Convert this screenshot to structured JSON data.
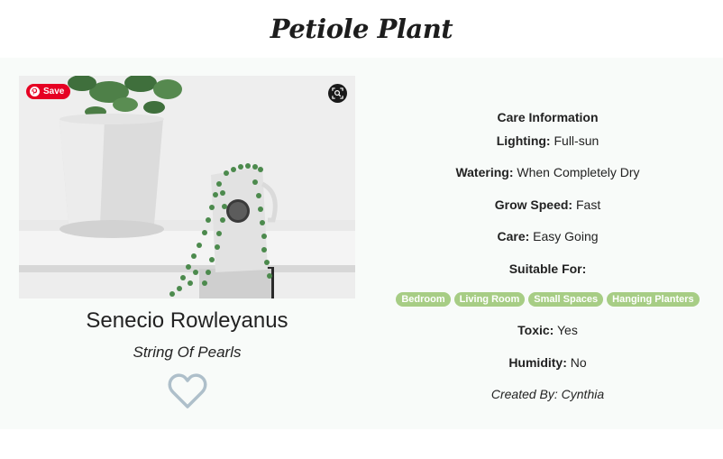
{
  "header": {
    "title": "Petiole Plant"
  },
  "photo": {
    "save_label": "Save",
    "alt": "String of pearls plant in a white pitcher next to a potted jade plant"
  },
  "plant": {
    "scientific_name": "Senecio Rowleyanus",
    "common_name": "String Of Pearls"
  },
  "care": {
    "heading": "Care Information",
    "lighting_label": "Lighting:",
    "lighting_value": "Full-sun",
    "watering_label": "Watering:",
    "watering_value": "When Completely Dry",
    "grow_speed_label": "Grow Speed:",
    "grow_speed_value": "Fast",
    "care_label": "Care:",
    "care_value": "Easy Going",
    "suitable_label": "Suitable For:",
    "suitable_tags": [
      "Bedroom",
      "Living Room",
      "Small Spaces",
      "Hanging Planters"
    ],
    "toxic_label": "Toxic:",
    "toxic_value": "Yes",
    "humidity_label": "Humidity:",
    "humidity_value": "No",
    "created_by": "Created By: Cynthia"
  },
  "colors": {
    "pinterest_red": "#e60023",
    "tag_green": "#a7cd85",
    "heart_outline": "#aebfca",
    "card_background": "#f8fbf9"
  },
  "icons": [
    "pinterest-icon",
    "visual-search-icon",
    "heart-outline-icon"
  ]
}
